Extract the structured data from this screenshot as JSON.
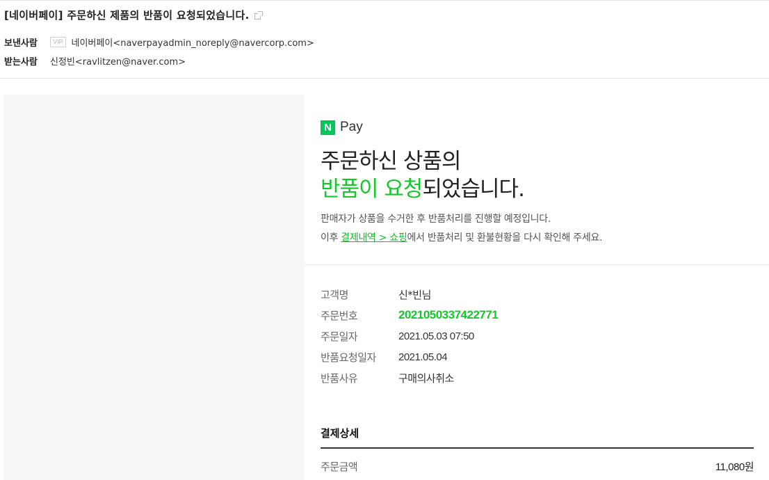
{
  "mail": {
    "subject": "[네이버페이] 주문하신 제품의 반품이 요청되었습니다.",
    "sender_label": "보낸사람",
    "vip_badge": "VIP",
    "sender_address": "네이버페이<naverpayadmin_noreply@navercorp.com>",
    "recipient_label": "받는사람",
    "recipient_address": "신정빈<ravlitzen@naver.com>"
  },
  "email_body": {
    "logo_letter": "N",
    "logo_text": "Pay",
    "headline_line1": "주문하신 상품의",
    "headline_green": "반품이 요청",
    "headline_rest": "되었습니다.",
    "desc_line1": "판매자가 상품을 수거한 후 반품처리를 진행할 예정입니다.",
    "desc_line2_prefix": "이후 ",
    "desc_line2_link": "결제내역 > 쇼핑",
    "desc_line2_suffix": "에서 반품처리 및 환불현황을 다시 확인해 주세요.",
    "details": [
      {
        "key": "고객명",
        "value": "신*빈님"
      },
      {
        "key": "주문번호",
        "value": "2021050337422771"
      },
      {
        "key": "주문일자",
        "value": "2021.05.03 07:50"
      },
      {
        "key": "반품요청일자",
        "value": "2021.05.04"
      },
      {
        "key": "반품사유",
        "value": "구매의사취소"
      }
    ],
    "payment_title": "결제상세",
    "payment_rows": [
      {
        "key": "주문금액",
        "value": "11,080원"
      }
    ]
  },
  "colors": {
    "accent_green": "#16c62a",
    "naver_green": "#03c75a"
  }
}
